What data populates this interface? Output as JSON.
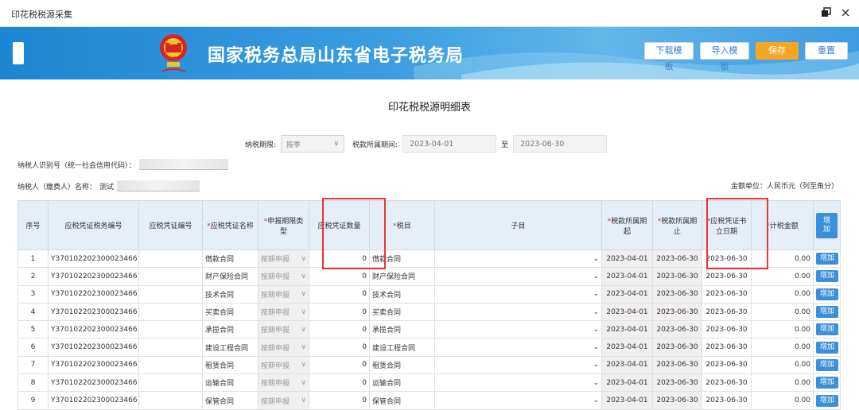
{
  "window": {
    "title": "印花税税源采集"
  },
  "header": {
    "bureau_name": "国家税务总局山东省电子税务局"
  },
  "toolbar": {
    "download_label": "下载模板",
    "import_label": "导入模板",
    "save_label": "保存",
    "reset_label": "重置"
  },
  "page": {
    "title": "印花税税源明细表"
  },
  "form": {
    "period_label": "纳税期限:",
    "period_value": "按季",
    "tax_period_label": "税款所属期间:",
    "start_date": "2023-04-01",
    "to_label": "至",
    "end_date": "2023-06-30",
    "taxpayer_id_label": "纳税人识别号（统一社会信用代码）：",
    "taxpayer_name_label": "纳税人（缴费人）名称：",
    "taxpayer_name_value": "测试",
    "unit_label": "金额单位：人民币元（列至角分）"
  },
  "table": {
    "headers": {
      "seq": "序号",
      "voucher_tax_no": "应税凭证税务编号",
      "voucher_no": "应税凭证编号",
      "voucher_name": "应税凭证名称",
      "declare_type": "申报期限类型",
      "voucher_qty": "应税凭证数量",
      "tax_item": "税目",
      "sub_item": "子目",
      "period_start": "税款所属期起",
      "period_end": "税款所属期止",
      "voucher_date": "应税凭证书立日期",
      "tax_amount": "计税金额",
      "add": "增加"
    },
    "rows": [
      {
        "seq": "1",
        "code": "Y370102202300023466",
        "name": "借款合同",
        "type": "按期申报",
        "qty": "0",
        "item": "借款合同",
        "start": "2023-04-01",
        "end": "2023-06-30",
        "date": "2023-06-30",
        "amount": "0.00",
        "add": "增加"
      },
      {
        "seq": "2",
        "code": "Y370102202300023466",
        "name": "财产保险合同",
        "type": "按期申报",
        "qty": "0",
        "item": "财产保险合同",
        "start": "2023-04-01",
        "end": "2023-06-30",
        "date": "2023-06-30",
        "amount": "0.00",
        "add": "增加"
      },
      {
        "seq": "3",
        "code": "Y370102202300023466",
        "name": "技术合同",
        "type": "按期申报",
        "qty": "0",
        "item": "技术合同",
        "start": "2023-04-01",
        "end": "2023-06-30",
        "date": "2023-06-30",
        "amount": "0.00",
        "add": "增加"
      },
      {
        "seq": "4",
        "code": "Y370102202300023466",
        "name": "买卖合同",
        "type": "按期申报",
        "qty": "0",
        "item": "买卖合同",
        "start": "2023-04-01",
        "end": "2023-06-30",
        "date": "2023-06-30",
        "amount": "0.00",
        "add": "增加"
      },
      {
        "seq": "5",
        "code": "Y370102202300023466",
        "name": "承揽合同",
        "type": "按期申报",
        "qty": "0",
        "item": "承揽合同",
        "start": "2023-04-01",
        "end": "2023-06-30",
        "date": "2023-06-30",
        "amount": "0.00",
        "add": "增加"
      },
      {
        "seq": "6",
        "code": "Y370102202300023466",
        "name": "建设工程合同",
        "type": "按期申报",
        "qty": "0",
        "item": "建设工程合同",
        "start": "2023-04-01",
        "end": "2023-06-30",
        "date": "2023-06-30",
        "amount": "0.00",
        "add": "增加"
      },
      {
        "seq": "7",
        "code": "Y370102202300023466",
        "name": "租赁合同",
        "type": "按期申报",
        "qty": "0",
        "item": "租赁合同",
        "start": "2023-04-01",
        "end": "2023-06-30",
        "date": "2023-06-30",
        "amount": "0.00",
        "add": "增加"
      },
      {
        "seq": "8",
        "code": "Y370102202300023466",
        "name": "运输合同",
        "type": "按期申报",
        "qty": "0",
        "item": "运输合同",
        "start": "2023-04-01",
        "end": "2023-06-30",
        "date": "2023-06-30",
        "amount": "0.00",
        "add": "增加"
      },
      {
        "seq": "9",
        "code": "Y370102202300023466",
        "name": "保管合同",
        "type": "按期申报",
        "qty": "0",
        "item": "保管合同",
        "start": "2023-04-01",
        "end": "2023-06-30",
        "date": "2023-06-30",
        "amount": "0.00",
        "add": "增加"
      }
    ]
  },
  "colors": {
    "banner": "#1d86d2",
    "header_bg": "#e6eef8",
    "add_button": "#3c8fd9",
    "save_button": "#f5a623",
    "highlight": "#e53935"
  }
}
